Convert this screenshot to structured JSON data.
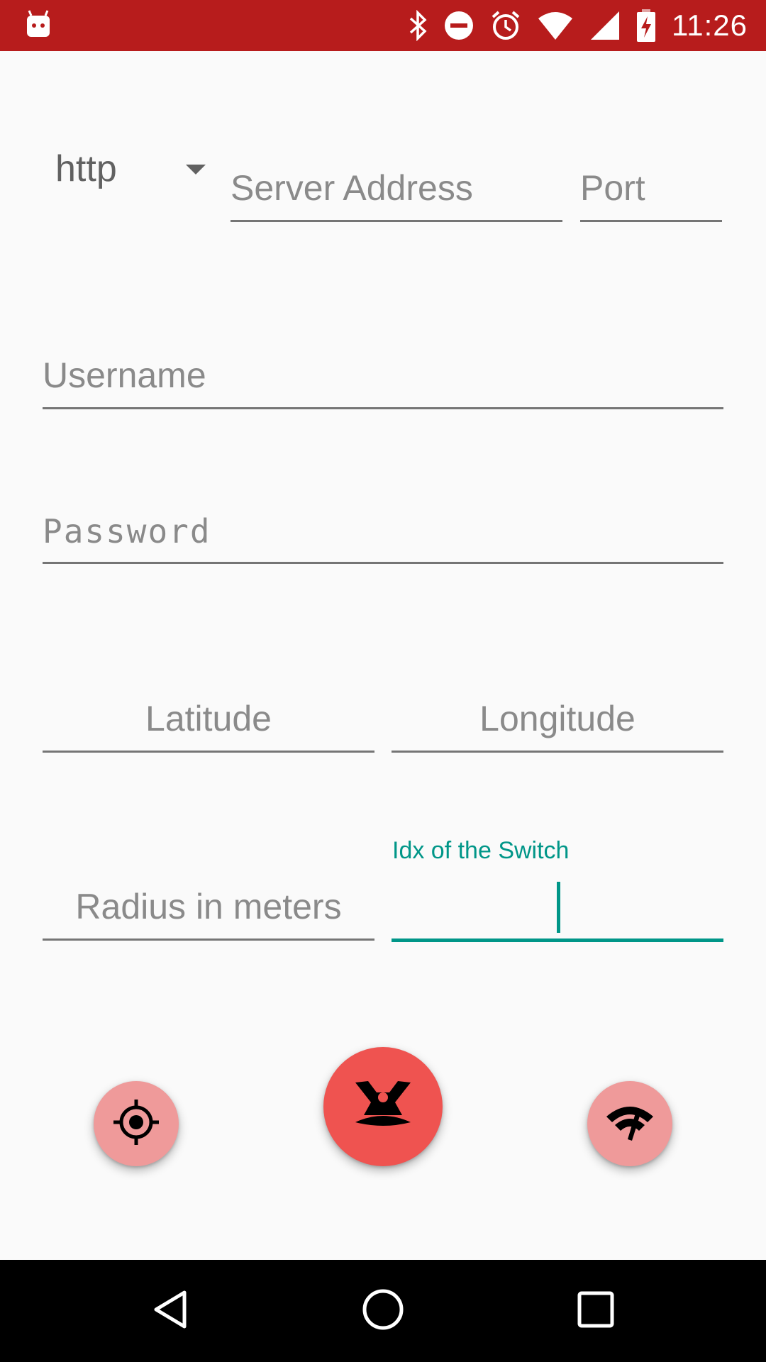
{
  "status_bar": {
    "time": "11:26",
    "icons": [
      "android-icon",
      "bluetooth-icon",
      "dnd-icon",
      "alarm-icon",
      "wifi-icon",
      "signal-icon",
      "battery-charging-icon"
    ],
    "background": "#b71c1c"
  },
  "form": {
    "protocol": {
      "selected": "http"
    },
    "server_address": {
      "placeholder": "Server Address"
    },
    "port": {
      "placeholder": "Port"
    },
    "username": {
      "placeholder": "Username"
    },
    "password": {
      "placeholder": "Password"
    },
    "latitude": {
      "placeholder": "Latitude"
    },
    "longitude": {
      "placeholder": "Longitude"
    },
    "radius": {
      "placeholder": "Radius in meters"
    },
    "idx": {
      "label": "Idx of the Switch",
      "value": ""
    }
  },
  "fabs": {
    "location": {
      "icon": "crosshair-icon"
    },
    "main": {
      "icon": "geofence-person-icon"
    },
    "network": {
      "icon": "wifi-speed-icon"
    }
  },
  "colors": {
    "accent": "#009688",
    "primary_dark": "#b71c1c",
    "fab_main": "#ef5350",
    "fab_secondary": "#ef9a9a"
  },
  "nav_bar": {
    "icons": [
      "back-icon",
      "home-icon",
      "recents-icon"
    ]
  }
}
